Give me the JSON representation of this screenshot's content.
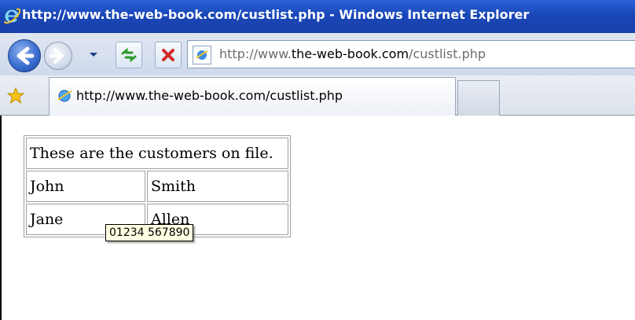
{
  "window": {
    "title": "http://www.the-web-book.com/custlist.php - Windows Internet Explorer"
  },
  "navigation": {
    "icons": [
      "back-icon",
      "forward-icon",
      "dropdown-icon",
      "refresh-icon",
      "stop-icon"
    ],
    "address": {
      "prefix": "http://www.",
      "domain": "the-web-book.com",
      "path": "/custlist.php"
    }
  },
  "tabs": [
    {
      "label": "http://www.the-web-book.com/custlist.php"
    }
  ],
  "content": {
    "table": {
      "header": "These are the customers on file.",
      "rows": [
        {
          "first": "John",
          "last": "Smith"
        },
        {
          "first": "Jane",
          "last": "Allen"
        }
      ]
    },
    "tooltip": "01234 567890"
  },
  "colors": {
    "titlebar": "#1947b8",
    "tooltip_bg": "#ffffe1"
  }
}
